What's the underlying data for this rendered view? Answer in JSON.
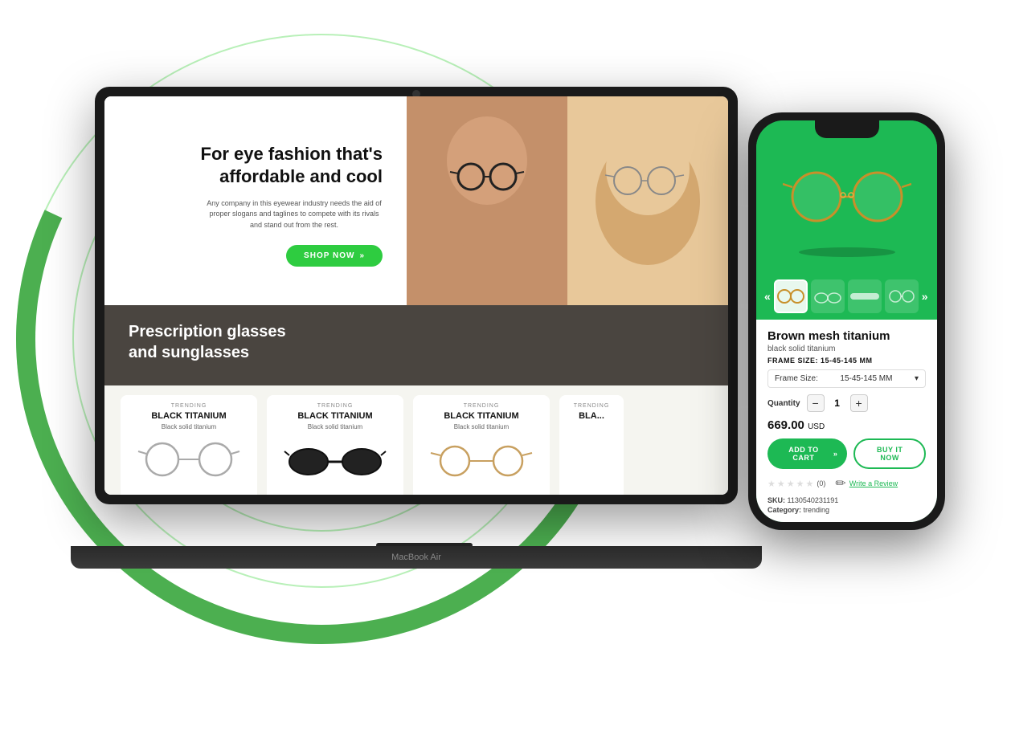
{
  "scene": {
    "background": "#ffffff"
  },
  "laptop": {
    "label": "MacBook Air",
    "website": {
      "hero": {
        "title": "For eye fashion that's\naffordable and cool",
        "subtitle": "Any company in this eyewear industry needs the aid of proper slogans and taglines to compete with its rivals and stand out from the rest.",
        "shop_btn": "SHOP NOW"
      },
      "dark_section": {
        "title": "Prescription glasses\nand sunglasses"
      },
      "products": [
        {
          "trending": "TRENDING",
          "name": "BLACK TITANIUM",
          "desc": "Black solid titanium"
        },
        {
          "trending": "TRENDING",
          "name": "BLACK TITANIUM",
          "desc": "Black solid titanium"
        },
        {
          "trending": "TRENDING",
          "name": "BLACK TITANIUM",
          "desc": "Black solid titanium"
        },
        {
          "trending": "TRENDING",
          "name": "BLA...",
          "desc": ""
        }
      ]
    }
  },
  "phone": {
    "product": {
      "title": "Brown mesh titanium",
      "subtitle": "black solid titanium",
      "frame_size_label": "FRAME SIZE: 15-45-145 MM",
      "frame_size_select_label": "Frame Size:",
      "frame_size_value": "15-45-145 MM",
      "quantity_label": "Quantity",
      "quantity_value": "1",
      "price": "669.00",
      "currency": "USD",
      "add_to_cart": "ADD TO CART",
      "buy_now": "BUY IT NOW",
      "rating_count": "(0)",
      "write_review": "Write a Review",
      "sku_label": "SKU:",
      "sku_value": "1130540231191",
      "category_label": "Category:",
      "category_value": "trending"
    },
    "thumbnails": {
      "prev": "«",
      "next": "»"
    }
  }
}
